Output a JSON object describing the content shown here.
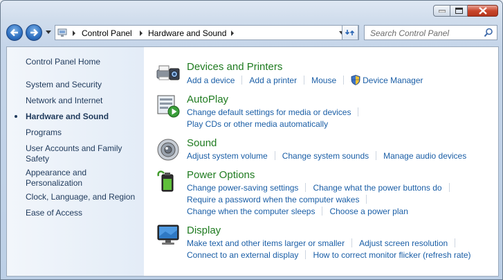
{
  "window": {
    "address_crumbs": [
      "Control Panel",
      "Hardware and Sound"
    ],
    "search_placeholder": "Search Control Panel"
  },
  "sidebar": {
    "items": [
      {
        "label": "Control Panel Home"
      },
      {
        "label": "System and Security"
      },
      {
        "label": "Network and Internet"
      },
      {
        "label": "Hardware and Sound",
        "active": true
      },
      {
        "label": "Programs"
      },
      {
        "label": "User Accounts and Family Safety"
      },
      {
        "label": "Appearance and Personalization"
      },
      {
        "label": "Clock, Language, and Region"
      },
      {
        "label": "Ease of Access"
      }
    ]
  },
  "categories": {
    "devices": {
      "title": "Devices and Printers",
      "links": [
        "Add a device",
        "Add a printer",
        "Mouse",
        "Device Manager"
      ]
    },
    "autoplay": {
      "title": "AutoPlay",
      "links": [
        "Change default settings for media or devices",
        "Play CDs or other media automatically"
      ]
    },
    "sound": {
      "title": "Sound",
      "links": [
        "Adjust system volume",
        "Change system sounds",
        "Manage audio devices"
      ]
    },
    "power": {
      "title": "Power Options",
      "links": [
        "Change power-saving settings",
        "Change what the power buttons do",
        "Require a password when the computer wakes",
        "Change when the computer sleeps",
        "Choose a power plan"
      ]
    },
    "display": {
      "title": "Display",
      "links": [
        "Make text and other items larger or smaller",
        "Adjust screen resolution",
        "Connect to an external display",
        "How to correct monitor flicker (refresh rate)"
      ]
    }
  },
  "colors": {
    "category_title": "#1f7b20",
    "link": "#1a5ea6",
    "sidebar_text": "#1e395b",
    "annotation_arrow": "#2e8b2e"
  }
}
